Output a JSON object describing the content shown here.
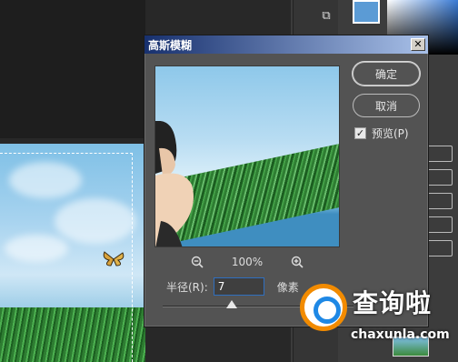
{
  "dialog": {
    "title": "高斯模糊",
    "close_label": "✕",
    "ok_label": "确定",
    "cancel_label": "取消",
    "preview_label": "预览(P)",
    "preview_checked": true,
    "zoom_out_icon": "zoom-out-icon",
    "zoom_in_icon": "zoom-in-icon",
    "zoom_level": "100%",
    "radius_label": "半径(R):",
    "radius_value": "7",
    "radius_unit": "像素"
  },
  "watermark": {
    "text": "查询啦",
    "url": "chaxunla.com"
  },
  "colors": {
    "title_bar_start": "#17306e",
    "title_bar_end": "#a8c0e8",
    "dialog_bg": "#535353",
    "workspace_bg": "#282828",
    "foreground_swatch": "#5b9bd5"
  }
}
